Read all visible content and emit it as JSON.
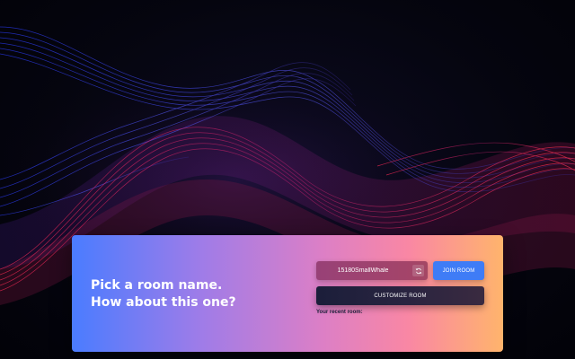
{
  "background": {
    "colors": {
      "base": "#04040c",
      "wave_blue": "#3a4dff",
      "wave_red": "#ff2a4a",
      "wave_purple": "#8b2cc9"
    }
  },
  "panel": {
    "prompt_line1": "Pick a room name.",
    "prompt_line2": "How about this one?",
    "room_name_value": "15180SmallWhale",
    "refresh_icon": "refresh-icon",
    "join_label": "JOIN ROOM",
    "customize_label": "CUSTOMIZE ROOM",
    "recent_label": "Your recent room:",
    "colors": {
      "gradient_start": "#4a7cff",
      "gradient_mid": "#dc7fc6",
      "gradient_end": "#ffb46c",
      "join_button": "#3f7cf6",
      "customize_button": "#1b1e3a"
    }
  }
}
